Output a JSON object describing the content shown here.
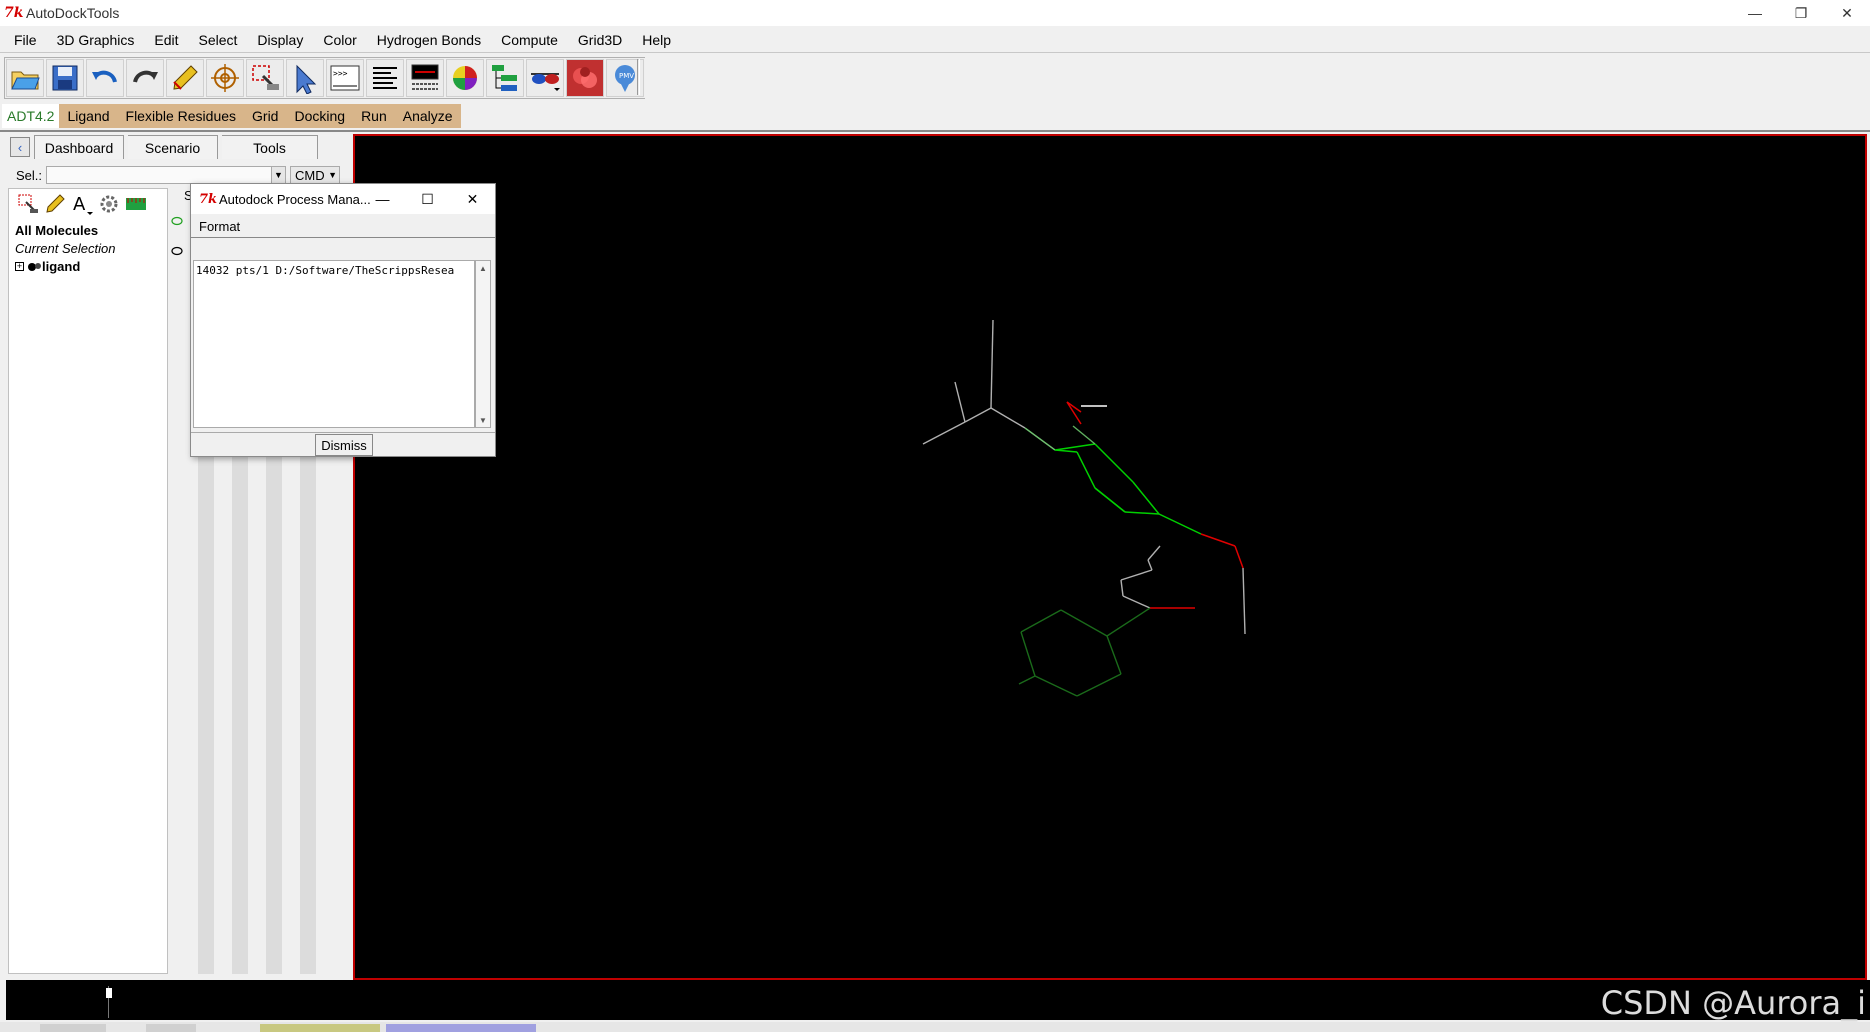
{
  "window": {
    "title": "AutoDockTools"
  },
  "menubar": [
    "File",
    "3D Graphics",
    "Edit",
    "Select",
    "Display",
    "Color",
    "Hydrogen Bonds",
    "Compute",
    "Grid3D",
    "Help"
  ],
  "toolbar": {
    "icons": [
      "open-folder-icon",
      "save-icon",
      "undo-icon",
      "redo-icon",
      "pencil-icon",
      "target-icon",
      "select-box-icon",
      "pointer-icon",
      "python-shell-icon",
      "text-lines-icon",
      "monitor-icon",
      "colored-sphere-icon",
      "tree-icon",
      "stereo-glasses-icon",
      "molecule-surface-icon",
      "pmv-logo-icon"
    ],
    "shell_prompt": ">>>"
  },
  "adtbar": {
    "version": "ADT4.2",
    "items": [
      "Ligand",
      "Flexible Residues",
      "Grid",
      "Docking",
      "Run",
      "Analyze"
    ]
  },
  "dashboard": {
    "tabs": [
      "Dashboard",
      "Scenario",
      "Tools"
    ],
    "sel_label": "Sel.:",
    "sel_value": "",
    "cmd_label": "CMD",
    "tree": {
      "all": "All Molecules",
      "current": "Current Selection",
      "molecule": "ligand"
    },
    "column_head": "S"
  },
  "dialog": {
    "title": "Autodock Process Mana...",
    "menu": [
      "Format"
    ],
    "process_line": "14032  pts/1 D:/Software/TheScrippsResea",
    "dismiss_label": "Dismiss"
  },
  "watermark": "CSDN @Aurora_i",
  "colors": {
    "viewer_bg": "#000000",
    "viewer_border": "#c00000",
    "adt_bar": "#d8b58a",
    "bond_green": "#00e000",
    "bond_gray": "#b0b0b0",
    "bond_red": "#e00000"
  }
}
